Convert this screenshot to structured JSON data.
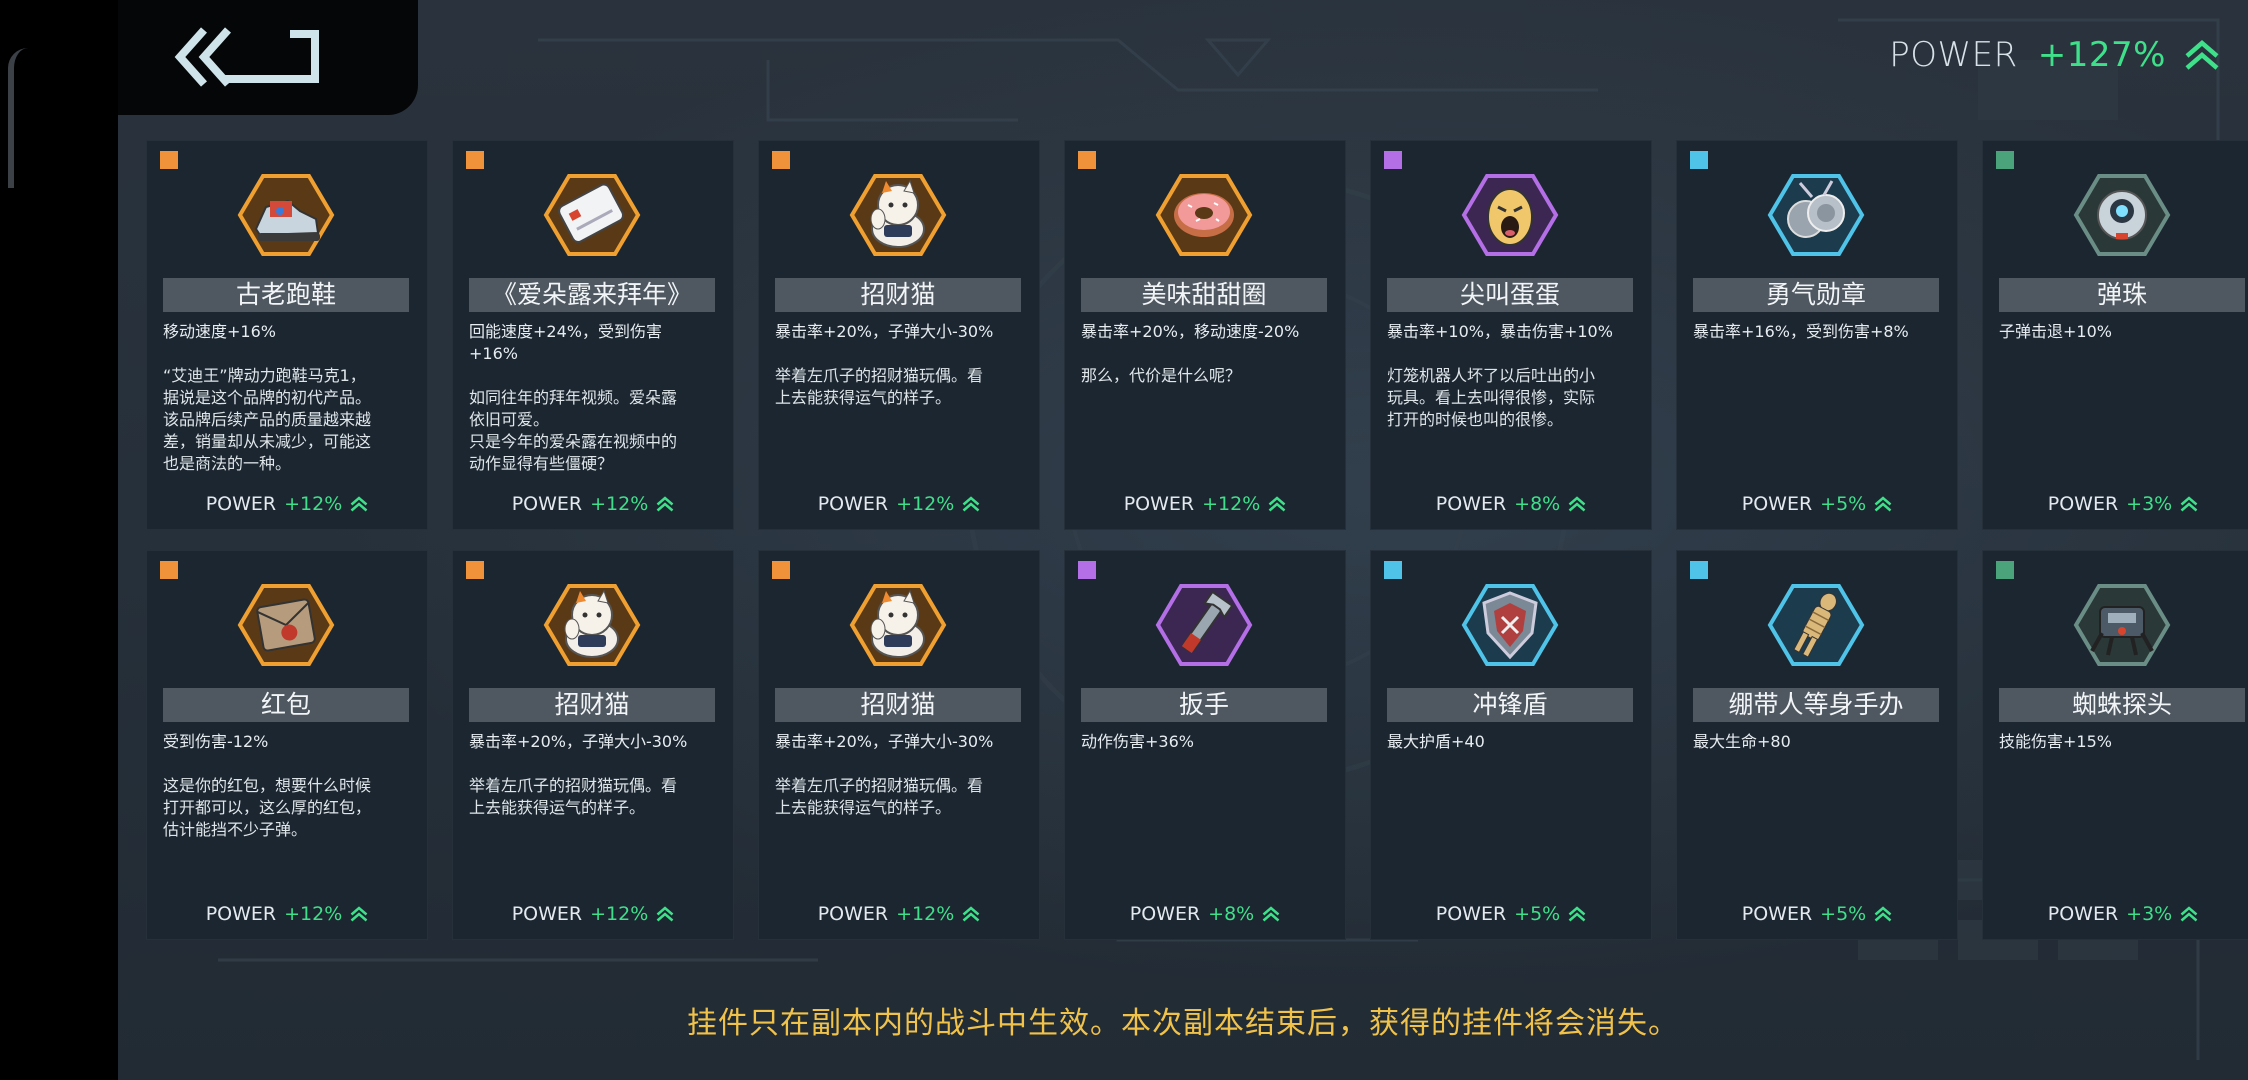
{
  "header": {
    "power_label": "POWER",
    "power_value": "+127%",
    "back_icon": "double-chevron-left-icon"
  },
  "colors": {
    "accent_green": "#3fe08a",
    "note_yellow": "#f0c24a",
    "rarity_orange": "#f0923a",
    "rarity_purple": "#b46ee6",
    "rarity_cyan": "#4fc3e8",
    "rarity_green": "#4aa37a"
  },
  "cards": [
    {
      "name": "古老跑鞋",
      "rarity": "orange",
      "icon": "old-sneaker-icon",
      "effect": "移动速度+16%",
      "description": "“艾迪王”牌动力跑鞋马克1，\n据说是这个品牌的初代产品。\n该品牌后续产品的质量越来越\n差，销量却从未减少，可能这\n也是商法的一种。",
      "power_label": "POWER",
      "power_value": "+12%"
    },
    {
      "name": "《爱朵露来拜年》",
      "rarity": "orange",
      "icon": "greeting-card-icon",
      "effect": "回能速度+24%，受到伤害\n+16%",
      "description": "如同往年的拜年视频。爱朵露\n依旧可爱。\n只是今年的爱朵露在视频中的\n动作显得有些僵硬？",
      "power_label": "POWER",
      "power_value": "+12%"
    },
    {
      "name": "招财猫",
      "rarity": "orange",
      "icon": "lucky-cat-icon",
      "effect": "暴击率+20%，子弹大小-30%",
      "description": "举着左爪子的招财猫玩偶。看\n上去能获得运气的样子。",
      "power_label": "POWER",
      "power_value": "+12%"
    },
    {
      "name": "美味甜甜圈",
      "rarity": "orange",
      "icon": "donut-icon",
      "effect": "暴击率+20%，移动速度-20%",
      "description": "那么，代价是什么呢？",
      "power_label": "POWER",
      "power_value": "+12%"
    },
    {
      "name": "尖叫蛋蛋",
      "rarity": "purple",
      "icon": "screaming-egg-icon",
      "effect": "暴击率+10%，暴击伤害+10%",
      "description": "灯笼机器人坏了以后吐出的小\n玩具。看上去叫得很惨，实际\n打开的时候也叫的很惨。",
      "power_label": "POWER",
      "power_value": "+8%"
    },
    {
      "name": "勇气勋章",
      "rarity": "cyan",
      "icon": "medal-icon",
      "effect": "暴击率+16%，受到伤害+8%",
      "description": "",
      "power_label": "POWER",
      "power_value": "+5%"
    },
    {
      "name": "弹珠",
      "rarity": "green",
      "icon": "marble-icon",
      "effect": "子弹击退+10%",
      "description": "",
      "power_label": "POWER",
      "power_value": "+3%"
    },
    {
      "name": "红包",
      "rarity": "orange",
      "icon": "red-envelope-icon",
      "effect": "受到伤害-12%",
      "description": "这是你的红包，想要什么时候\n打开都可以，这么厚的红包，\n估计能挡不少子弹。",
      "power_label": "POWER",
      "power_value": "+12%"
    },
    {
      "name": "招财猫",
      "rarity": "orange",
      "icon": "lucky-cat-icon",
      "effect": "暴击率+20%，子弹大小-30%",
      "description": "举着左爪子的招财猫玩偶。看\n上去能获得运气的样子。",
      "power_label": "POWER",
      "power_value": "+12%"
    },
    {
      "name": "招财猫",
      "rarity": "orange",
      "icon": "lucky-cat-icon",
      "effect": "暴击率+20%，子弹大小-30%",
      "description": "举着左爪子的招财猫玩偶。看\n上去能获得运气的样子。",
      "power_label": "POWER",
      "power_value": "+12%"
    },
    {
      "name": "扳手",
      "rarity": "purple",
      "icon": "wrench-icon",
      "effect": "动作伤害+36%",
      "description": "",
      "power_label": "POWER",
      "power_value": "+8%"
    },
    {
      "name": "冲锋盾",
      "rarity": "cyan",
      "icon": "shield-icon",
      "effect": "最大护盾+40",
      "description": "",
      "power_label": "POWER",
      "power_value": "+5%"
    },
    {
      "name": "绷带人等身手办",
      "rarity": "cyan",
      "icon": "mummy-figure-icon",
      "effect": "最大生命+80",
      "description": "",
      "power_label": "POWER",
      "power_value": "+5%"
    },
    {
      "name": "蜘蛛探头",
      "rarity": "green",
      "icon": "spider-probe-icon",
      "effect": "技能伤害+15%",
      "description": "",
      "power_label": "POWER",
      "power_value": "+3%"
    }
  ],
  "footer": {
    "note": "挂件只在副本内的战斗中生效。本次副本结束后，获得的挂件将会消失。"
  }
}
